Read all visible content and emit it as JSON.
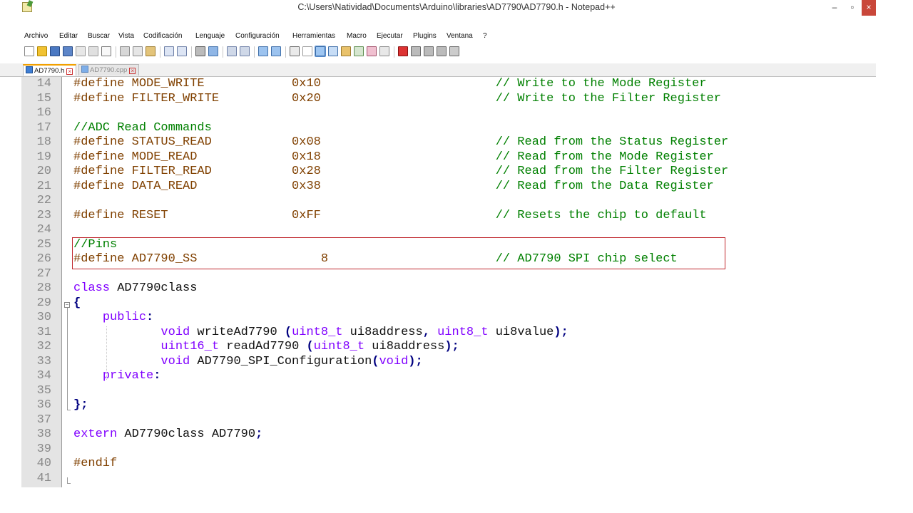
{
  "window": {
    "title": "C:\\Users\\Natividad\\Documents\\Arduino\\libraries\\AD7790\\AD7790.h - Notepad++",
    "minimize": "–",
    "maximize": "▫",
    "close": "×"
  },
  "menu": [
    "Archivo",
    "Editar",
    "Buscar",
    "Vista",
    "Codificación",
    "Lenguaje",
    "Configuración",
    "Herramientas",
    "Macro",
    "Ejecutar",
    "Plugins",
    "Ventana",
    "?"
  ],
  "tabs": [
    {
      "label": "AD7790.h",
      "active": true
    },
    {
      "label": "AD7790.cpp",
      "active": false
    }
  ],
  "editor": {
    "lines": [
      {
        "no": "14",
        "parts": [
          [
            "pp",
            "#define MODE_WRITE            0x10                        "
          ],
          [
            "cm",
            "// Write to the Mode Register"
          ]
        ]
      },
      {
        "no": "15",
        "parts": [
          [
            "pp",
            "#define FILTER_WRITE          0x20                        "
          ],
          [
            "cm",
            "// Write to the Filter Register"
          ]
        ]
      },
      {
        "no": "16",
        "parts": []
      },
      {
        "no": "17",
        "parts": [
          [
            "cm",
            "//ADC Read Commands"
          ]
        ]
      },
      {
        "no": "18",
        "parts": [
          [
            "pp",
            "#define STATUS_READ           0x08                        "
          ],
          [
            "cm",
            "// Read from the Status Register"
          ]
        ]
      },
      {
        "no": "19",
        "parts": [
          [
            "pp",
            "#define MODE_READ             0x18                        "
          ],
          [
            "cm",
            "// Read from the Mode Register"
          ]
        ]
      },
      {
        "no": "20",
        "parts": [
          [
            "pp",
            "#define FILTER_READ           0x28                        "
          ],
          [
            "cm",
            "// Read from the Filter Register"
          ]
        ]
      },
      {
        "no": "21",
        "parts": [
          [
            "pp",
            "#define DATA_READ             0x38                        "
          ],
          [
            "cm",
            "// Read from the Data Register"
          ]
        ]
      },
      {
        "no": "22",
        "parts": []
      },
      {
        "no": "23",
        "parts": [
          [
            "pp",
            "#define RESET                 0xFF                        "
          ],
          [
            "cm",
            "// Resets the chip to default"
          ]
        ]
      },
      {
        "no": "24",
        "parts": []
      },
      {
        "no": "25",
        "parts": [
          [
            "cm",
            "//Pins"
          ]
        ]
      },
      {
        "no": "26",
        "parts": [
          [
            "pp",
            "#define AD7790_SS                 8                       "
          ],
          [
            "cm",
            "// AD7790 SPI chip select"
          ]
        ]
      },
      {
        "no": "27",
        "parts": []
      },
      {
        "no": "28",
        "parts": [
          [
            "kw",
            "class"
          ],
          [
            "plain",
            " AD7790class"
          ]
        ]
      },
      {
        "no": "29",
        "parts": [
          [
            "op",
            "{"
          ]
        ]
      },
      {
        "no": "30",
        "parts": [
          [
            "plain",
            "    "
          ],
          [
            "kw",
            "public"
          ],
          [
            "op",
            ":"
          ]
        ]
      },
      {
        "no": "31",
        "parts": [
          [
            "plain",
            "            "
          ],
          [
            "kw",
            "void"
          ],
          [
            "plain",
            " writeAd7790 "
          ],
          [
            "op",
            "("
          ],
          [
            "kw",
            "uint8_t"
          ],
          [
            "plain",
            " ui8address"
          ],
          [
            "op",
            ","
          ],
          [
            "plain",
            " "
          ],
          [
            "kw",
            "uint8_t"
          ],
          [
            "plain",
            " ui8value"
          ],
          [
            "op",
            ");"
          ]
        ]
      },
      {
        "no": "32",
        "parts": [
          [
            "plain",
            "            "
          ],
          [
            "kw",
            "uint16_t"
          ],
          [
            "plain",
            " readAd7790 "
          ],
          [
            "op",
            "("
          ],
          [
            "kw",
            "uint8_t"
          ],
          [
            "plain",
            " ui8address"
          ],
          [
            "op",
            ");"
          ]
        ]
      },
      {
        "no": "33",
        "parts": [
          [
            "plain",
            "            "
          ],
          [
            "kw",
            "void"
          ],
          [
            "plain",
            " AD7790_SPI_Configuration"
          ],
          [
            "op",
            "("
          ],
          [
            "kw",
            "void"
          ],
          [
            "op",
            ");"
          ]
        ]
      },
      {
        "no": "34",
        "parts": [
          [
            "plain",
            "    "
          ],
          [
            "kw",
            "private"
          ],
          [
            "op",
            ":"
          ]
        ]
      },
      {
        "no": "35",
        "parts": []
      },
      {
        "no": "36",
        "parts": [
          [
            "op",
            "};"
          ]
        ]
      },
      {
        "no": "37",
        "parts": []
      },
      {
        "no": "38",
        "parts": [
          [
            "kw",
            "extern"
          ],
          [
            "plain",
            " AD7790class AD7790"
          ],
          [
            "op",
            ";"
          ]
        ]
      },
      {
        "no": "39",
        "parts": []
      },
      {
        "no": "40",
        "parts": [
          [
            "pp",
            "#endif"
          ]
        ]
      },
      {
        "no": "41",
        "parts": []
      }
    ]
  },
  "colors": {
    "preprocessor": "#804000",
    "comment": "#008000",
    "keyword": "#8000ff",
    "operator": "#000080",
    "highlight_box": "#c0272d"
  }
}
